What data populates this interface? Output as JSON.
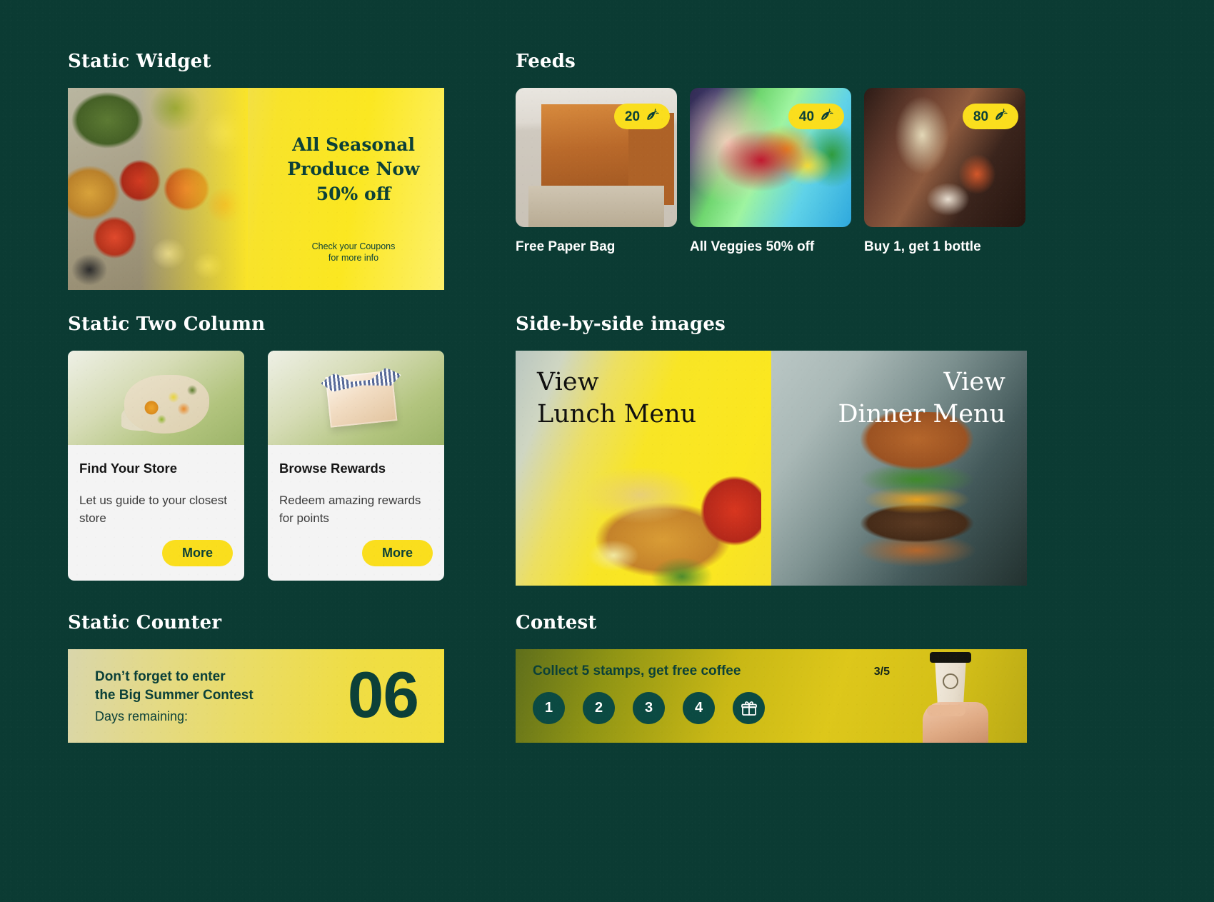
{
  "theme": {
    "background": "#0b3b33",
    "accent_yellow": "#fade1d",
    "dark_green": "#0b4038",
    "card_bg": "#f4f4f4"
  },
  "sections": {
    "static_widget": {
      "title": "Static Widget"
    },
    "feeds": {
      "title": "Feeds"
    },
    "static_two_column": {
      "title": "Static Two Column"
    },
    "side_by_side": {
      "title": "Side-by-side images"
    },
    "static_counter": {
      "title": "Static Counter"
    },
    "contest": {
      "title": "Contest"
    }
  },
  "static_widget": {
    "headline": "All Seasonal Produce Now 50% off",
    "subtext_line1": "Check your Coupons",
    "subtext_line2": "for more info",
    "image_alt": "crate-of-seasonal-produce"
  },
  "feeds": {
    "items": [
      {
        "badge_value": "20",
        "badge_icon": "carrot-icon",
        "caption": "Free Paper Bag",
        "image_alt": "paper-shopping-bags"
      },
      {
        "badge_value": "40",
        "badge_icon": "carrot-icon",
        "caption": "All Veggies 50% off",
        "image_alt": "hands-holding-vegetables"
      },
      {
        "badge_value": "80",
        "badge_icon": "carrot-icon",
        "caption": "Buy 1, get 1 bottle",
        "image_alt": "wine-glass-and-tapas"
      }
    ]
  },
  "two_column": {
    "cards": [
      {
        "title": "Find Your Store",
        "text": "Let us guide to your closest store",
        "button_label": "More",
        "image_alt": "mesh-bag-with-fruit"
      },
      {
        "title": "Browse Rewards",
        "text": "Redeem amazing rewards for points",
        "button_label": "More",
        "image_alt": "gift-box-with-ribbon"
      }
    ]
  },
  "side_by_side": {
    "panes": [
      {
        "label_line1": "View",
        "label_line2": "Lunch Menu",
        "image_alt": "fried-fish-and-fries"
      },
      {
        "label_line1": "View",
        "label_line2": "Dinner Menu",
        "image_alt": "cheeseburger"
      }
    ]
  },
  "static_counter": {
    "line1": "Don’t forget to enter",
    "line2": "the Big Summer Contest",
    "line3": "Days remaining:",
    "value": "06"
  },
  "contest": {
    "title": "Collect 5 stamps, get free coffee",
    "progress": "3/5",
    "stamps": [
      {
        "label": "1",
        "type": "number"
      },
      {
        "label": "2",
        "type": "number"
      },
      {
        "label": "3",
        "type": "number"
      },
      {
        "label": "4",
        "type": "number"
      },
      {
        "label": "🎁",
        "type": "gift-icon"
      }
    ],
    "image_alt": "hand-holding-coffee-cup"
  }
}
